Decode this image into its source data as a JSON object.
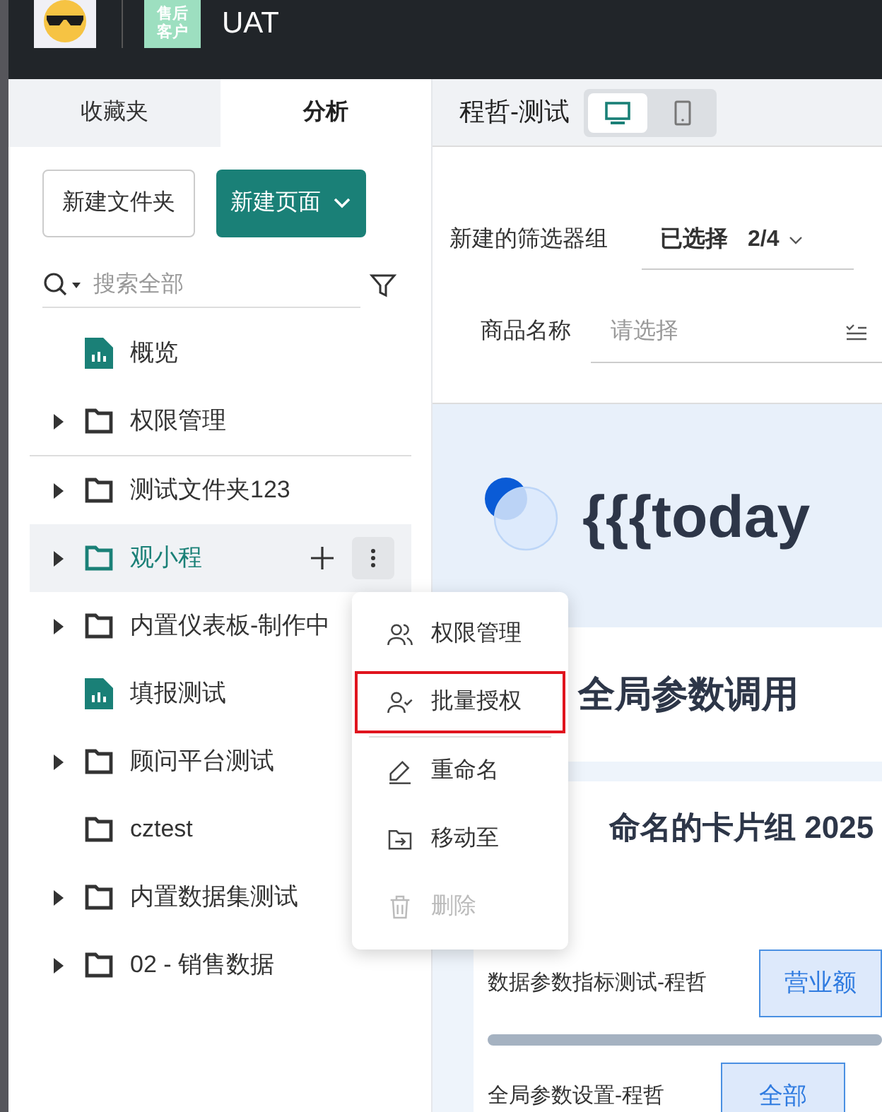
{
  "topbar": {
    "badge_lines": [
      "售后",
      "客户"
    ],
    "title": "UAT"
  },
  "sidebar": {
    "tabs": [
      {
        "label": "收藏夹",
        "selected": false
      },
      {
        "label": "分析",
        "selected": true
      }
    ],
    "buttons": [
      {
        "label": "新建文件夹",
        "kind": "outline"
      },
      {
        "label": "新建页面",
        "kind": "primary"
      }
    ],
    "search": {
      "placeholder": "搜索全部"
    },
    "tree": [
      {
        "label": "概览",
        "kind": "report",
        "has_children": false,
        "selected": false
      },
      {
        "label": "权限管理",
        "kind": "folder",
        "has_children": true,
        "selected": false,
        "divider_after": true
      },
      {
        "label": "测试文件夹123",
        "kind": "folder",
        "has_children": true,
        "selected": false
      },
      {
        "label": "观小程",
        "kind": "folder",
        "has_children": true,
        "selected": true
      },
      {
        "label": "内置仪表板-制作中",
        "kind": "folder",
        "has_children": true,
        "selected": false
      },
      {
        "label": "填报测试",
        "kind": "report",
        "has_children": false,
        "selected": false
      },
      {
        "label": "顾问平台测试",
        "kind": "folder",
        "has_children": true,
        "selected": false
      },
      {
        "label": "cztest",
        "kind": "folder",
        "has_children": false,
        "selected": false
      },
      {
        "label": "内置数据集测试",
        "kind": "folder",
        "has_children": true,
        "selected": false
      },
      {
        "label": "02 - 销售数据",
        "kind": "folder",
        "has_children": true,
        "selected": false
      }
    ]
  },
  "context_menu": [
    {
      "label": "权限管理",
      "kind": "permissions",
      "disabled": false,
      "highlighted": false
    },
    {
      "label": "批量授权",
      "kind": "authorize",
      "disabled": false,
      "highlighted": true
    },
    {
      "label": "重命名",
      "kind": "rename",
      "disabled": false,
      "highlighted": false
    },
    {
      "label": "移动至",
      "kind": "move",
      "disabled": false,
      "highlighted": false
    },
    {
      "label": "删除",
      "kind": "delete",
      "disabled": true,
      "highlighted": false
    }
  ],
  "main": {
    "page_title": "程哲-测试",
    "view_toggle": [
      {
        "kind": "desktop",
        "selected": true
      },
      {
        "kind": "mobile",
        "selected": false
      }
    ],
    "filter_group": {
      "label": "新建的筛选器组",
      "selected_label": "已选择",
      "count": "2/4"
    },
    "filter": {
      "label": "商品名称",
      "placeholder": "请选择"
    },
    "banner_text": "{{{today",
    "section_title": "全局参数调用",
    "card_title": "命名的卡片组 2025",
    "params": [
      {
        "label": "数据参数指标测试-程哲",
        "value": "营业额"
      },
      {
        "label": "全局参数设置-程哲",
        "value": "全部"
      }
    ]
  }
}
